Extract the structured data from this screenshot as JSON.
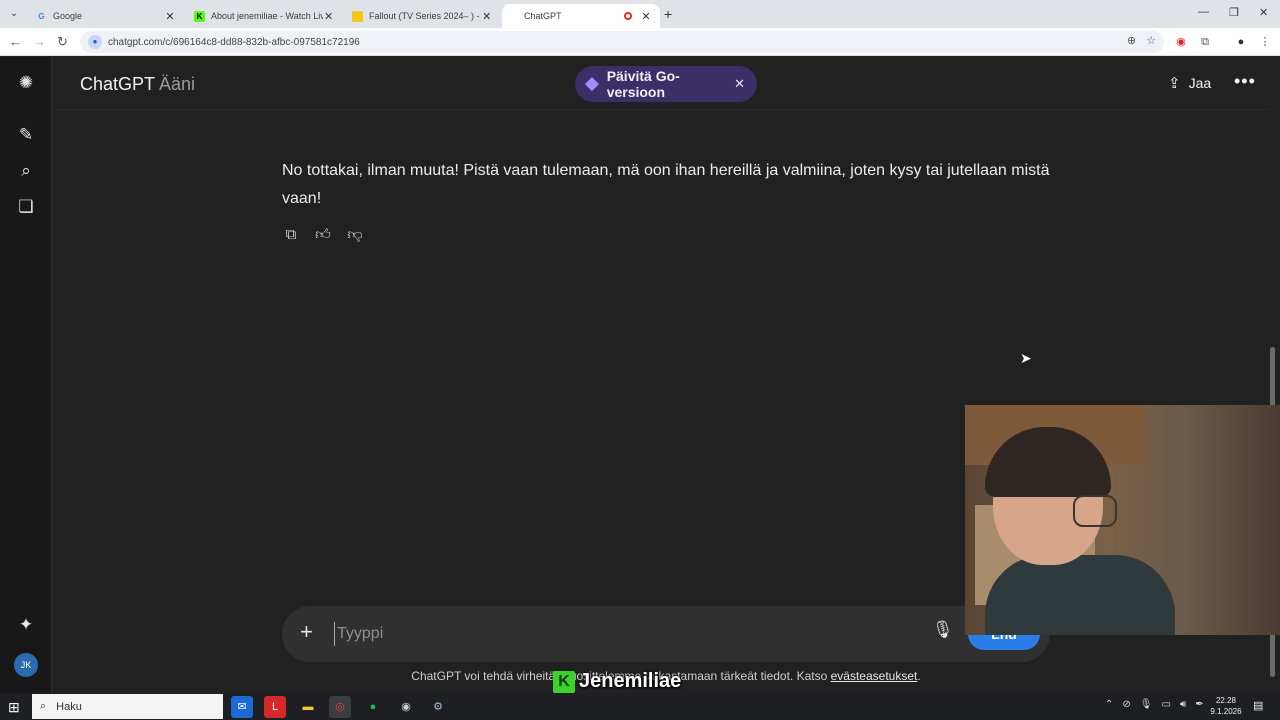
{
  "browser": {
    "tabs": [
      {
        "title": "Google",
        "favicon": "google-icon",
        "active": false
      },
      {
        "title": "About jenemiliae - Watch Live o",
        "favicon": "kick-icon",
        "active": false
      },
      {
        "title": "Fallout (TV Series 2024– ) - IMD",
        "favicon": "imdb-icon",
        "active": false
      },
      {
        "title": "ChatGPT",
        "favicon": "",
        "active": true,
        "recording": true
      }
    ],
    "url": "chatgpt.com/c/696164c8-dd88-832b-afbc-097581c72196"
  },
  "app": {
    "title": "ChatGPT",
    "subtitle": "Ääni",
    "upgrade_label": "Päivitä Go-versioon",
    "share_label": "Jaa",
    "message": "No tottakai, ilman muuta! Pistä vaan tulemaan, mä oon ihan hereillä ja valmiina, joten kysy tai jutellaan mistä vaan!",
    "composer": {
      "placeholder": "Tyyppi",
      "end_label": "Lnd"
    },
    "disclaimer": "ChatGPT voi tehdä virheitä. Suosittelemme tarkastamaan tärkeät tiedot. Katso ",
    "disclaimer_link": "evästeasetukset",
    "disclaimer_end": ".",
    "avatar_initials": "JK"
  },
  "overlay": {
    "streamer_name": "Jenemiliae",
    "badge": "K"
  },
  "taskbar": {
    "search_label": "Haku",
    "time": "22.28",
    "date": "9.1.2026"
  },
  "colors": {
    "background": "#212121",
    "upgrade_pill": "#3b2f66",
    "end_button": "#2b7de9"
  }
}
